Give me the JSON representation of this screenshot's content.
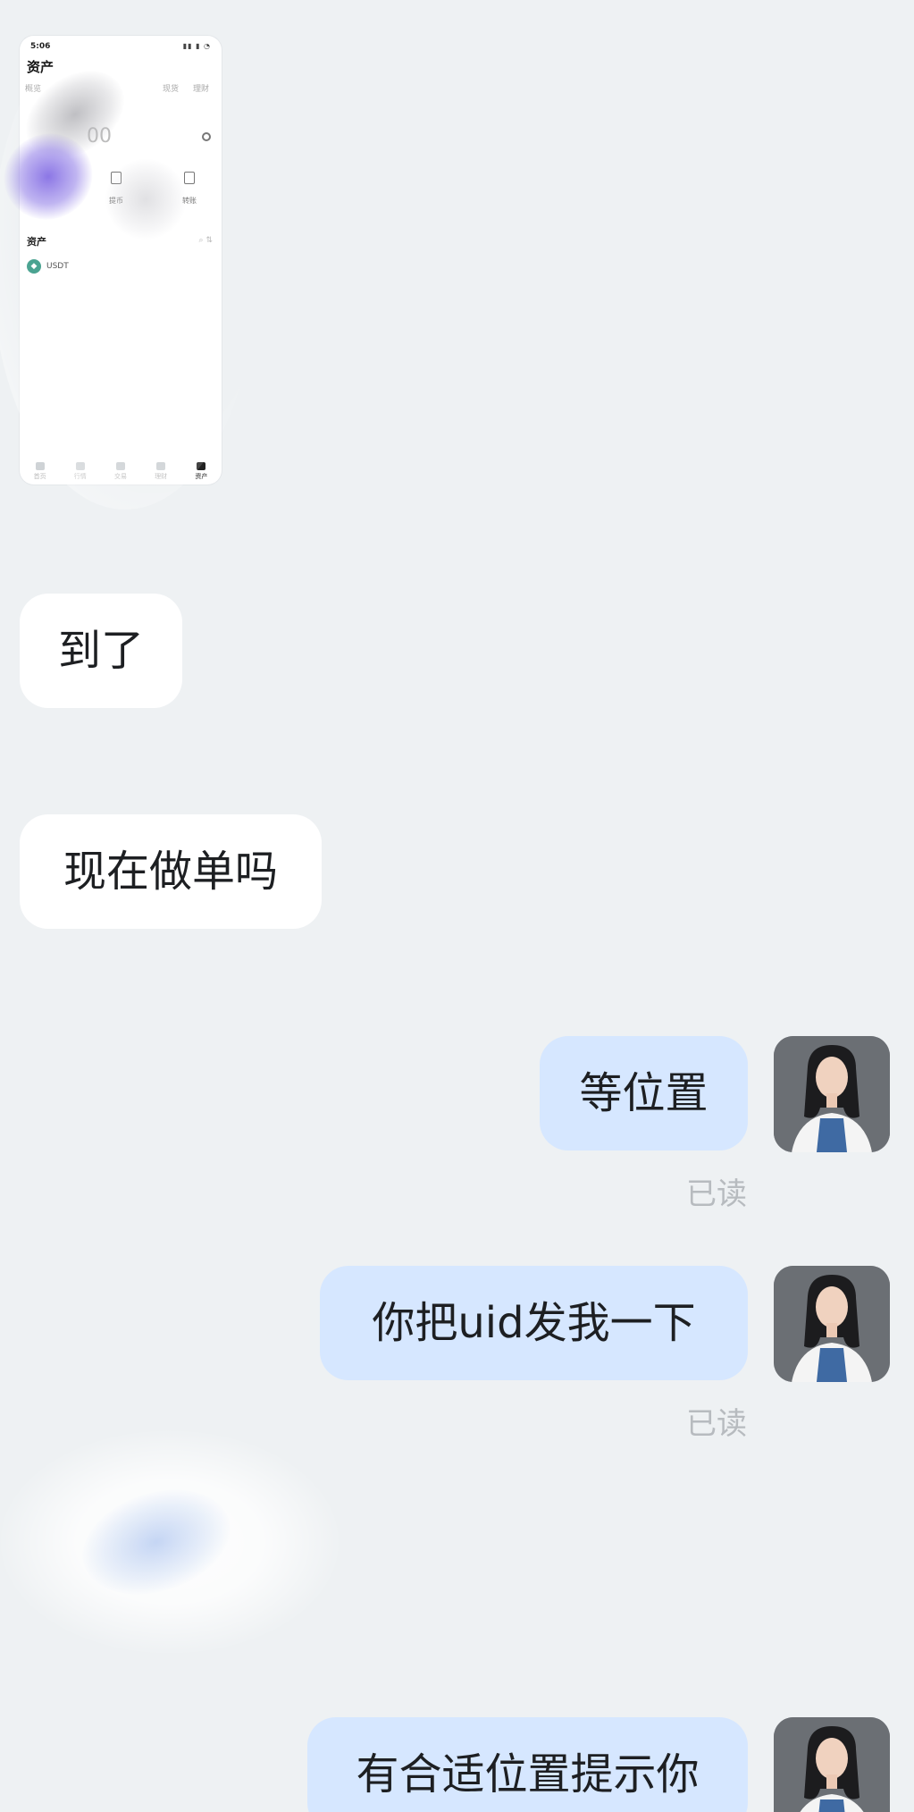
{
  "screenshot": {
    "status_time": "5:06",
    "title": "资产",
    "tabs": [
      "概览",
      "",
      "",
      "现货",
      "理财"
    ],
    "balance": "00",
    "actions": [
      "提币",
      "转账"
    ],
    "section_title": "资产",
    "asset_name": "USDT",
    "nav_labels": [
      "首页",
      "行情",
      "交易",
      "理财",
      "资产"
    ]
  },
  "messages": [
    {
      "direction": "incoming",
      "text": "到了"
    },
    {
      "direction": "incoming",
      "text": "现在做单吗"
    },
    {
      "direction": "outgoing",
      "text": "等位置",
      "status": "已读"
    },
    {
      "direction": "outgoing",
      "text": "你把uid发我一下",
      "status": "已读"
    },
    {
      "direction": "outgoing",
      "text": "有合适位置提示你"
    }
  ],
  "colors": {
    "background": "#eef1f3",
    "incoming_bubble": "#ffffff",
    "outgoing_bubble": "#d6e7ff",
    "read_status": "#b7bbbf"
  }
}
